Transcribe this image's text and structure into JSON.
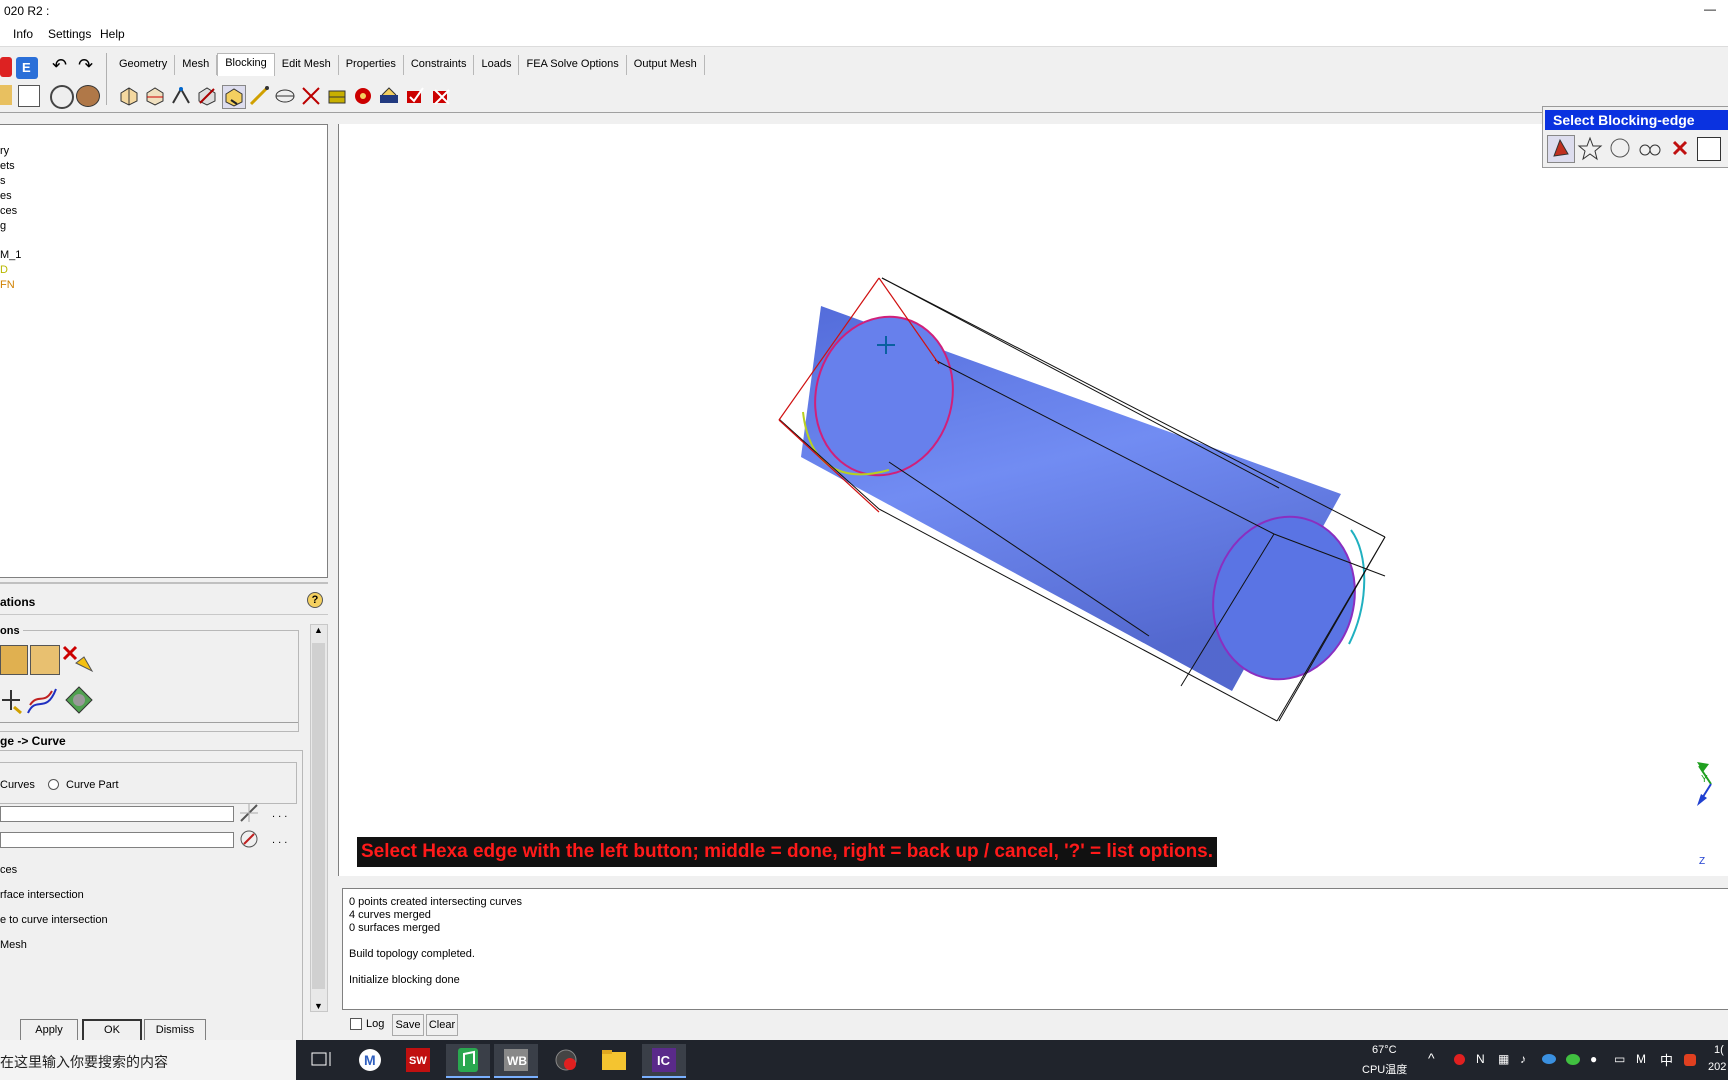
{
  "window": {
    "title": "020 R2 :"
  },
  "menu": {
    "items": [
      "Info",
      "Settings",
      "Help"
    ]
  },
  "tabs": [
    "Geometry",
    "Mesh",
    "Blocking",
    "Edit Mesh",
    "Properties",
    "Constraints",
    "Loads",
    "FEA Solve Options",
    "Output Mesh"
  ],
  "active_tab": "Blocking",
  "tree": {
    "items": [
      "ry",
      "ets",
      "s",
      "es",
      "ces",
      "g",
      "M_1",
      "D",
      "FN"
    ],
    "colors": {
      "D": "#c8c800",
      "FN": "#d08000"
    }
  },
  "panel": {
    "title": "ations",
    "help_icon": "help-icon",
    "group1_label": "ons",
    "section_label": "ge -> Curve",
    "radio1": "Curves",
    "radio2": "Curve Part",
    "field_dots": ". . .",
    "options": [
      "ces",
      "rface intersection",
      "e to curve intersection",
      "Mesh"
    ]
  },
  "buttons": {
    "apply": "Apply",
    "ok": "OK",
    "dismiss": "Dismiss"
  },
  "select_dialog": {
    "title": "Select Blocking-edge"
  },
  "viewport": {
    "message": "Select Hexa edge with the left button; middle = done, right = back up / cancel, '?' = list options.",
    "axis_y": "Y",
    "axis_z": "Z"
  },
  "log": {
    "lines": [
      "0 points created intersecting curves",
      "4 curves merged",
      "0 surfaces merged",
      "",
      "Build topology completed.",
      "",
      "Initialize blocking done"
    ],
    "log_label": "Log",
    "save_label": "Save",
    "clear_label": "Clear"
  },
  "taskbar": {
    "search_placeholder": "在这里输入你要搜索的内容",
    "temp": "67°C",
    "temp_label": "CPU温度",
    "ime": "中",
    "clock_top": "1(",
    "clock_bottom": "202"
  }
}
